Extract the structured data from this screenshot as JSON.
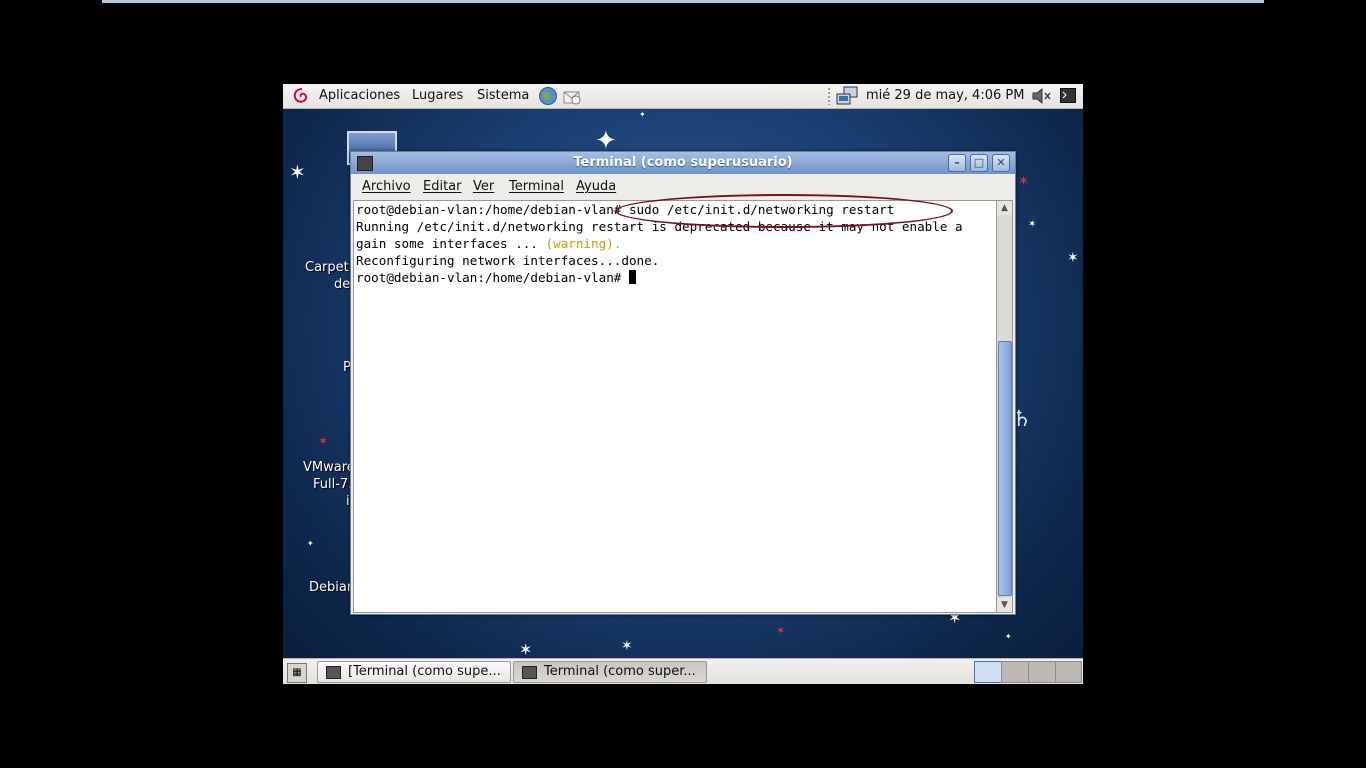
{
  "top_panel": {
    "menus": [
      "Aplicaciones",
      "Lugares",
      "Sistema"
    ],
    "clock": "mié 29 de may,  4:06 PM",
    "icons": [
      "debian-swirl-icon",
      "web-browser-icon",
      "mail-client-icon",
      "network-icon",
      "volume-icon",
      "terminal-icon"
    ]
  },
  "desktop": {
    "icon_labels": [
      "Carpet",
      "de",
      "P",
      "VMware",
      "Full-7.",
      "i",
      "Debian"
    ]
  },
  "window": {
    "title": "Terminal (como superusuario)",
    "menu": [
      "Archivo",
      "Editar",
      "Ver",
      "Terminal",
      "Ayuda"
    ],
    "terminal": {
      "line1_prompt": "root@debian-vlan:/home/debian-vlan#",
      "line1_command": " sudo /etc/init.d/networking restart",
      "line2": "Running /etc/init.d/networking restart is deprecated because it may not enable a",
      "line3_text": "gain some interfaces ... ",
      "line3_warning": "(warning).",
      "line4": "Reconfiguring network interfaces...done.",
      "line5_prompt": "root@debian-vlan:/home/debian-vlan# "
    }
  },
  "taskbar": {
    "tasks": [
      "[Terminal (como supe...",
      "Terminal (como super..."
    ]
  },
  "colors": {
    "warning_text": "#c89c10",
    "annotation_oval": "#7a1020",
    "title_bar": "#7f9fcf"
  }
}
